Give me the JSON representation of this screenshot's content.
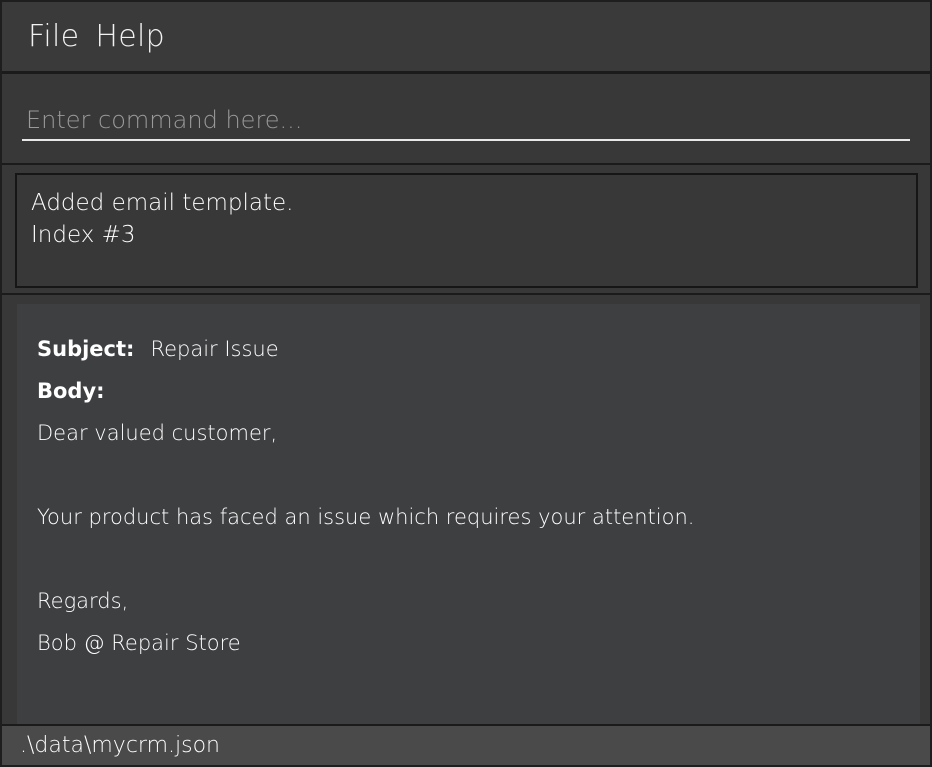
{
  "menu": {
    "file_label": "File",
    "help_label": "Help"
  },
  "command": {
    "value": "",
    "placeholder": "Enter command here..."
  },
  "result": {
    "lines": [
      "Added email template.",
      "Index #3"
    ]
  },
  "template": {
    "subject_label": "Subject:",
    "subject_value": "Repair Issue",
    "body_label": "Body:",
    "body_lines": [
      "Dear valued customer,",
      "",
      "Your product has faced an issue which requires your attention.",
      "",
      "Regards,",
      "Bob @ Repair Store"
    ]
  },
  "status": {
    "file_path": ".\\data\\mycrm.json"
  },
  "colors": {
    "background": "#383838",
    "panel": "#3e3f41",
    "status_bar": "#4a4a4a",
    "border": "#1b1b1b",
    "text": "#ffffff",
    "placeholder": "#9a9a9a"
  }
}
